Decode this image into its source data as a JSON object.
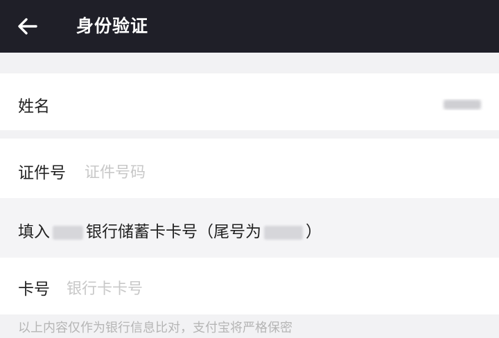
{
  "header": {
    "back_icon": "arrow-left-icon",
    "title": "身份验证",
    "background": "#1f1f28"
  },
  "form": {
    "name": {
      "label": "姓名",
      "value_masked": true
    },
    "id_number": {
      "label": "证件号",
      "placeholder": "证件号码"
    },
    "notice": {
      "prefix": "填入",
      "middle": "银行储蓄卡卡号（尾号为",
      "suffix": "）"
    },
    "card_number": {
      "label": "卡号",
      "placeholder": "银行卡卡号"
    }
  },
  "footer": {
    "text": "以上内容仅作为银行信息比对，支付宝将严格保密"
  }
}
